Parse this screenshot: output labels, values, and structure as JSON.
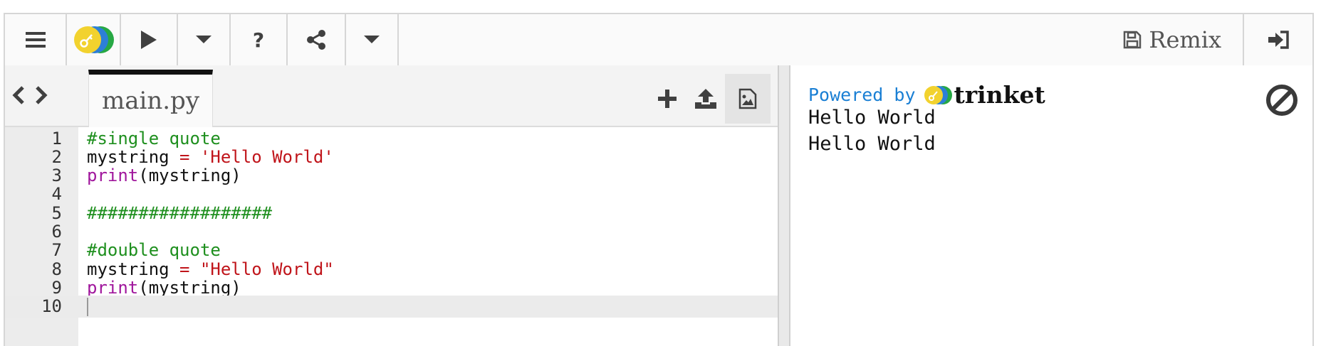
{
  "toolbar": {
    "menu_icon": "hamburger-icon",
    "logo_icon": "trinket-logo-icon",
    "run_icon": "play-icon",
    "run_menu_icon": "caret-down-icon",
    "help_icon": "question-icon",
    "share_icon": "share-icon",
    "share_menu_icon": "caret-down-icon",
    "remix_label": "Remix",
    "remix_icon": "floppy-disk-icon",
    "login_icon": "sign-in-icon"
  },
  "editor": {
    "tab_label": "main.py",
    "actions": [
      "plus-icon",
      "upload-icon",
      "image-icon"
    ],
    "lines": [
      {
        "num": "1",
        "parts": [
          {
            "t": "#single quote",
            "c": "comment"
          }
        ]
      },
      {
        "num": "2",
        "parts": [
          {
            "t": "mystring ",
            "c": ""
          },
          {
            "t": "=",
            "c": "op"
          },
          {
            "t": " ",
            "c": ""
          },
          {
            "t": "'Hello World'",
            "c": "str"
          }
        ]
      },
      {
        "num": "3",
        "parts": [
          {
            "t": "print",
            "c": "kw"
          },
          {
            "t": "(mystring)",
            "c": ""
          }
        ]
      },
      {
        "num": "4",
        "parts": []
      },
      {
        "num": "5",
        "parts": [
          {
            "t": "##################",
            "c": "comment"
          }
        ]
      },
      {
        "num": "6",
        "parts": []
      },
      {
        "num": "7",
        "parts": [
          {
            "t": "#double quote",
            "c": "comment"
          }
        ]
      },
      {
        "num": "8",
        "parts": [
          {
            "t": "mystring ",
            "c": ""
          },
          {
            "t": "=",
            "c": "op"
          },
          {
            "t": " ",
            "c": ""
          },
          {
            "t": "\"Hello World\"",
            "c": "str"
          }
        ]
      },
      {
        "num": "9",
        "parts": [
          {
            "t": "print",
            "c": "kw"
          },
          {
            "t": "(mystring)",
            "c": ""
          }
        ]
      },
      {
        "num": "10",
        "parts": [],
        "current": true
      }
    ]
  },
  "output": {
    "powered_by": "Powered by",
    "brand": "trinket",
    "lines": [
      "Hello World",
      "Hello World"
    ],
    "stop_icon": "ban-icon"
  },
  "colors": {
    "comment": "#1e8f1e",
    "string": "#c0141a",
    "keyword": "#a0169c",
    "powered": "#1a7fd4"
  }
}
